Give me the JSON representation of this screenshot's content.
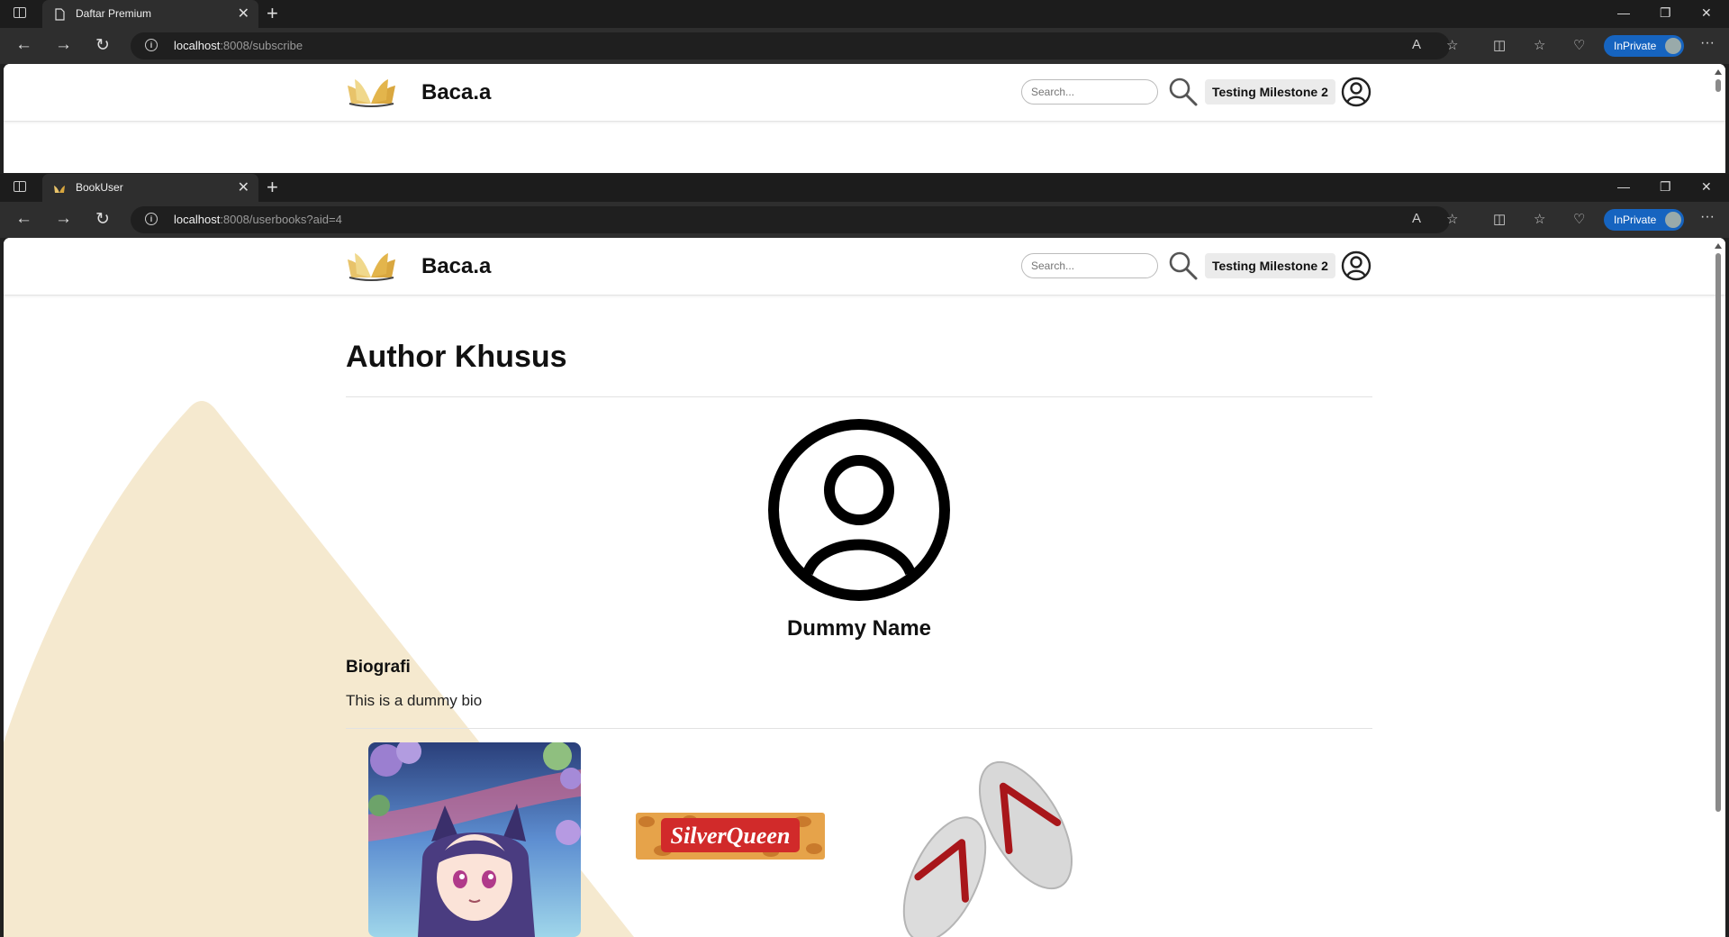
{
  "browser_back": {
    "tab_title": "Daftar Premium",
    "url_host": "localhost",
    "url_rest": ":8008/subscribe"
  },
  "browser_front": {
    "tab_title": "BookUser",
    "url_host": "localhost",
    "url_rest": ":8008/userbooks?aid=4"
  },
  "browser": {
    "inprivate_label": "InPrivate",
    "new_tab_glyph": "+",
    "close_tab_glyph": "✕",
    "more_glyph": "···"
  },
  "site": {
    "brand": "Baca.a",
    "search_placeholder": "Search...",
    "username": "Testing Milestone 2"
  },
  "page": {
    "title": "Author Khusus",
    "author_name": "Dummy Name",
    "bio_heading": "Biografi",
    "bio_text": "This is a dummy bio",
    "books": [
      {
        "image": "anime-girl-cover"
      },
      {
        "image": "silverqueen-chocolate",
        "logo_text": "SilverQueen"
      },
      {
        "image": "flip-flop-sandals"
      }
    ]
  },
  "colors": {
    "accent_cream": "#f5e9cf",
    "inprivate_blue": "#1664c0",
    "logo_gold": "#d9a73f"
  }
}
